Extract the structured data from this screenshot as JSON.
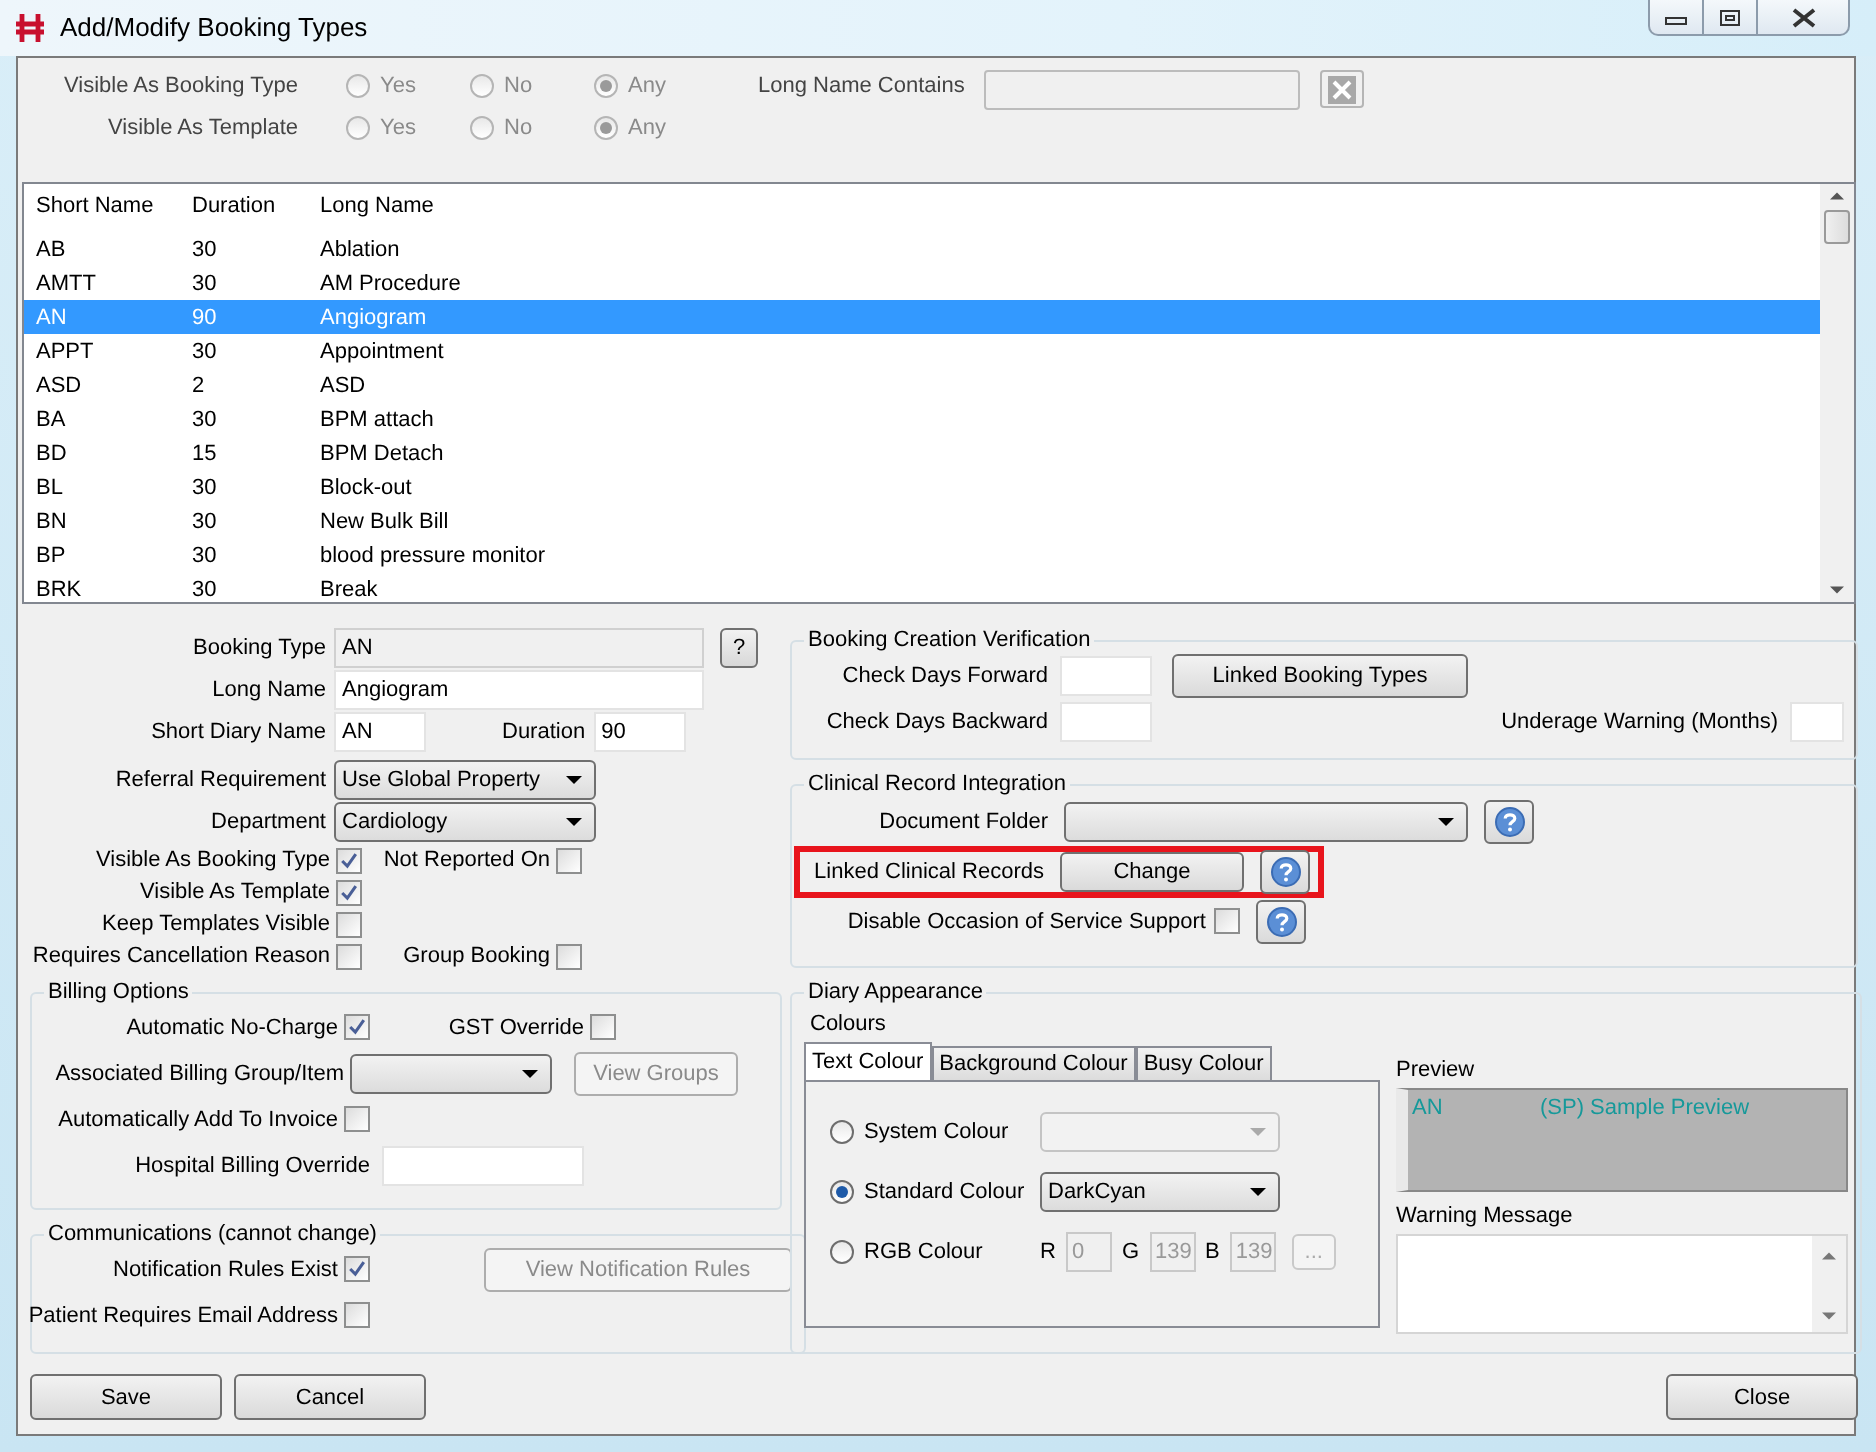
{
  "window": {
    "title": "Add/Modify Booking Types"
  },
  "filters": [
    {
      "label": "Visible As Booking Type",
      "options": [
        {
          "label": "Yes",
          "selected": false
        },
        {
          "label": "No",
          "selected": false
        },
        {
          "label": "Any",
          "selected": true
        }
      ]
    },
    {
      "label": "Visible As Template",
      "options": [
        {
          "label": "Yes",
          "selected": false
        },
        {
          "label": "No",
          "selected": false
        },
        {
          "label": "Any",
          "selected": true
        }
      ]
    }
  ],
  "long_name_filter": {
    "label": "Long Name Contains"
  },
  "table": {
    "columns": [
      "Short Name",
      "Duration",
      "Long Name"
    ],
    "rows": [
      {
        "cells": [
          "AB",
          "30",
          "Ablation"
        ],
        "selected": false
      },
      {
        "cells": [
          "AMTT",
          "30",
          "AM Procedure"
        ],
        "selected": false
      },
      {
        "cells": [
          "AN",
          "90",
          "Angiogram"
        ],
        "selected": true
      },
      {
        "cells": [
          "APPT",
          "30",
          "Appointment"
        ],
        "selected": false
      },
      {
        "cells": [
          "ASD",
          "2",
          "ASD"
        ],
        "selected": false
      },
      {
        "cells": [
          "BA",
          "30",
          "BPM attach"
        ],
        "selected": false
      },
      {
        "cells": [
          "BD",
          "15",
          "BPM Detach"
        ],
        "selected": false
      },
      {
        "cells": [
          "BL",
          "30",
          "Block-out"
        ],
        "selected": false
      },
      {
        "cells": [
          "BN",
          "30",
          "New Bulk Bill"
        ],
        "selected": false
      },
      {
        "cells": [
          "BP",
          "30",
          "blood pressure monitor"
        ],
        "selected": false
      },
      {
        "cells": [
          "BRK",
          "30",
          "Break"
        ],
        "selected": false
      }
    ]
  },
  "details": {
    "booking_type": {
      "label": "Booking Type",
      "value": "AN"
    },
    "help_button": "?",
    "long_name": {
      "label": "Long Name",
      "value": "Angiogram"
    },
    "short_diary_name": {
      "label": "Short Diary Name",
      "value": "AN"
    },
    "duration": {
      "label": "Duration",
      "value": "90"
    },
    "referral_requirement": {
      "label": "Referral Requirement",
      "value": "Use Global Property"
    },
    "department": {
      "label": "Department",
      "value": "Cardiology"
    },
    "flag_rows": [
      [
        {
          "label": "Visible As Booking Type",
          "checked": true
        },
        {
          "label": "Not Reported On",
          "checked": false
        }
      ],
      [
        {
          "label": "Visible As Template",
          "checked": true
        }
      ],
      [
        {
          "label": "Keep Templates Visible",
          "checked": false
        }
      ],
      [
        {
          "label": "Requires Cancellation Reason",
          "checked": false
        },
        {
          "label": "Group Booking",
          "checked": false
        }
      ]
    ]
  },
  "billing": {
    "title": "Billing Options",
    "automatic_no_charge": {
      "label": "Automatic No-Charge",
      "checked": true
    },
    "gst_override": {
      "label": "GST Override",
      "checked": false
    },
    "billing_group": {
      "label": "Associated Billing Group/Item"
    },
    "view_groups": {
      "label": "View Groups",
      "disabled": true
    },
    "auto_add_invoice": {
      "label": "Automatically Add To Invoice",
      "checked": false
    },
    "hospital_billing_override": {
      "label": "Hospital Billing Override"
    }
  },
  "communications": {
    "title": "Communications (cannot change)",
    "notification_rules_exist": {
      "label": "Notification Rules Exist",
      "checked": true
    },
    "view_notification_rules": {
      "label": "View Notification Rules",
      "disabled": true
    },
    "patient_requires_email": {
      "label": "Patient Requires Email Address",
      "checked": false
    }
  },
  "verification": {
    "title": "Booking Creation Verification",
    "check_days_forward": {
      "label": "Check Days Forward"
    },
    "linked_booking_types": "Linked Booking Types",
    "check_days_backward": {
      "label": "Check Days Backward"
    },
    "underage_warning": {
      "label": "Underage Warning (Months)"
    }
  },
  "clinical": {
    "title": "Clinical Record Integration",
    "document_folder": {
      "label": "Document Folder"
    },
    "linked_clinical_records": {
      "label": "Linked Clinical Records",
      "button": "Change",
      "highlighted": true
    },
    "disable_occasion": {
      "label": "Disable Occasion of Service Support",
      "checked": false
    }
  },
  "diary": {
    "title": "Diary Appearance",
    "colours_label": "Colours",
    "tabs": [
      {
        "label": "Text Colour",
        "selected": true
      },
      {
        "label": "Background Colour",
        "selected": false
      },
      {
        "label": "Busy Colour",
        "selected": false
      }
    ],
    "colour_options": [
      {
        "kind": "system",
        "label": "System Colour",
        "selected": false
      },
      {
        "kind": "standard",
        "label": "Standard Colour",
        "selected": true,
        "value": "DarkCyan"
      },
      {
        "kind": "rgb",
        "label": "RGB Colour",
        "selected": false,
        "disabled": true,
        "channels": [
          {
            "label": "R",
            "value": "0"
          },
          {
            "label": "G",
            "value": "139"
          },
          {
            "label": "B",
            "value": "139"
          }
        ],
        "button": "..."
      }
    ],
    "preview": {
      "label": "Preview",
      "code": "AN",
      "text": "(SP) Sample Preview"
    },
    "warning": {
      "label": "Warning Message"
    }
  },
  "buttons": {
    "save": "Save",
    "cancel": "Cancel",
    "close": "Close"
  }
}
